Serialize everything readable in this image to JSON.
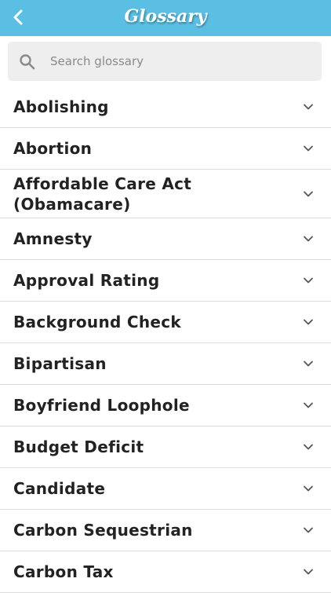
{
  "colors": {
    "accent": "#5bbfe3"
  },
  "header": {
    "title": "Glossary",
    "back_icon": "chevron-left-icon"
  },
  "search": {
    "placeholder": "Search glossary",
    "value": "",
    "icon": "search-icon"
  },
  "glossary": {
    "items": [
      {
        "label": "Abolishing"
      },
      {
        "label": "Abortion"
      },
      {
        "label": "Affordable Care Act (Obamacare)"
      },
      {
        "label": "Amnesty"
      },
      {
        "label": "Approval Rating"
      },
      {
        "label": "Background Check"
      },
      {
        "label": "Bipartisan"
      },
      {
        "label": "Boyfriend Loophole"
      },
      {
        "label": "Budget Deficit"
      },
      {
        "label": "Candidate"
      },
      {
        "label": "Carbon Sequestrian"
      },
      {
        "label": "Carbon Tax"
      }
    ],
    "expand_icon": "chevron-down-icon"
  }
}
